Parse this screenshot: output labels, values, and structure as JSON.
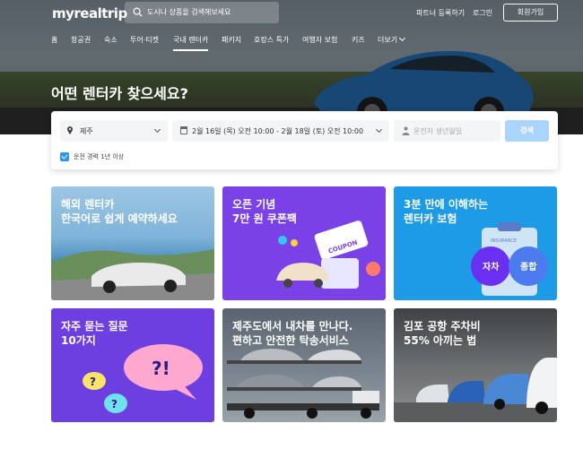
{
  "header": {
    "logo": "myrealtrip",
    "search_placeholder": "도시나 상품을 검색해보세요",
    "partner": "파트너 등록하기",
    "login": "로그인",
    "signup": "회원가입"
  },
  "nav": [
    {
      "label": "홈"
    },
    {
      "label": "항공권"
    },
    {
      "label": "숙소"
    },
    {
      "label": "투어·티켓"
    },
    {
      "label": "국내 렌터카"
    },
    {
      "label": "패키지"
    },
    {
      "label": "호캉스 특가"
    },
    {
      "label": "여행자 보험"
    },
    {
      "label": "키즈"
    },
    {
      "label": "더보기"
    }
  ],
  "hero": {
    "title": "어떤 렌터카 찾으세요?"
  },
  "search_panel": {
    "location": "제주",
    "dates": "2월 16일 (목) 오전 10:00 - 2월 18일 (토) 오전 10:00",
    "birth_placeholder": "운전자 생년월일",
    "search_button": "검색",
    "experience_label": "운전 경력 1년 이상",
    "experience_checked": true
  },
  "cards": [
    {
      "line1": "해외 렌터카",
      "line2": "한국어로 쉽게 예약하세요"
    },
    {
      "line1": "오픈 기념",
      "line2": "7만 원 쿠폰팩",
      "coupon": "COUPON"
    },
    {
      "line1": "3분 만에 이해하는",
      "line2": "렌터카 보험",
      "sign": "INSURANCE",
      "b1": "자차",
      "b2": "종합"
    },
    {
      "line1": "자주 묻는 질문",
      "line2": "10가지",
      "bubble": "?!",
      "q": "?"
    },
    {
      "line1": "제주도에서 내차를 만나다.",
      "line2": "편하고 안전한 탁송서비스"
    },
    {
      "line1": "김포 공항 주차비",
      "line2": "55% 아끼는 법"
    }
  ],
  "colors": {
    "accent": "#2b96ed",
    "search_button": "#a9d4fb",
    "card_purple": "#7a42e6",
    "card_blue": "#1d9be6"
  }
}
